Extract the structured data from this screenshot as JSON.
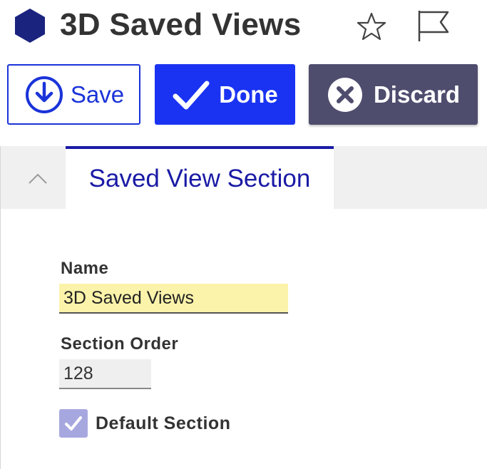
{
  "header": {
    "title": "3D Saved Views",
    "icon": "hexagon-icon",
    "icon_color": "#1a237e"
  },
  "toolbar": {
    "save_label": "Save",
    "done_label": "Done",
    "discard_label": "Discard",
    "save_color": "#1a33d9",
    "done_color": "#1a33f2",
    "discard_color": "#4f4d6e"
  },
  "section": {
    "tab_label": "Saved View Section",
    "collapse_icon": "chevron-up-icon"
  },
  "form": {
    "name_label": "Name",
    "name_value": "3D Saved Views",
    "order_label": "Section Order",
    "order_value": "128",
    "default_label": "Default Section",
    "default_checked": true
  }
}
